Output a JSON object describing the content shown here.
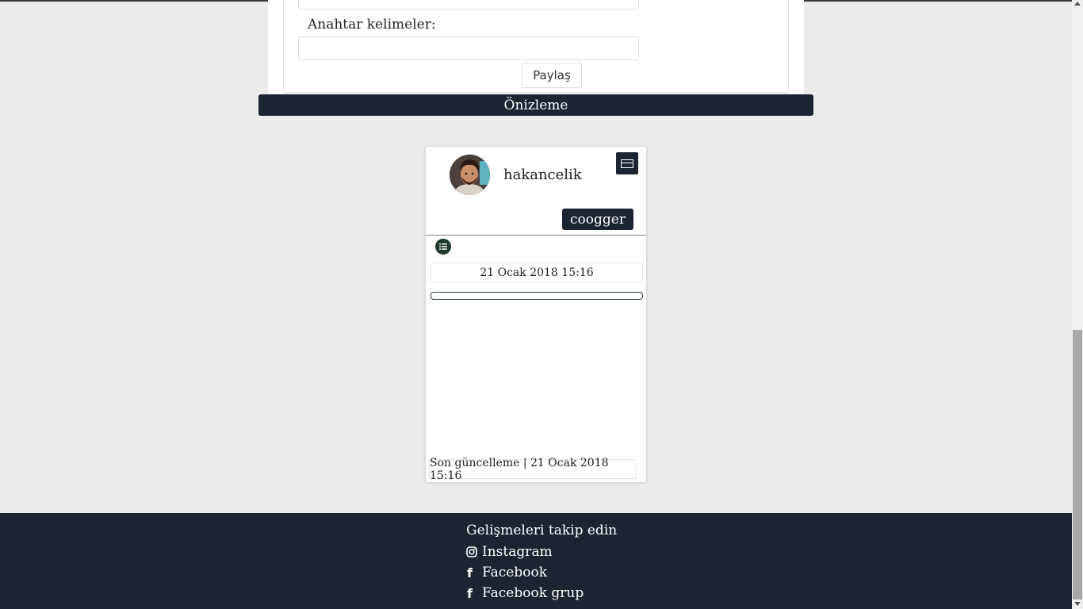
{
  "form": {
    "keywords_label": "Anahtar kelimeler:",
    "keywords_value": "",
    "share_label": "Paylaş"
  },
  "preview": {
    "title": "Önizleme"
  },
  "card": {
    "username": "hakancelik",
    "tag_label": "coogger",
    "date": "21 Ocak 2018 15:16",
    "updated": "Son güncelleme | 21 Ocak 2018 15:16"
  },
  "footer": {
    "title": "Gelişmeleri takip edin",
    "links": [
      {
        "label": "Instagram",
        "icon": "instagram-icon"
      },
      {
        "label": "Facebook",
        "icon": "facebook-icon"
      },
      {
        "label": "Facebook grup",
        "icon": "facebook-icon"
      }
    ]
  },
  "colors": {
    "dark": "#1c2432",
    "page_bg": "#ebebeb",
    "accent_green": "#1f3a2a"
  }
}
